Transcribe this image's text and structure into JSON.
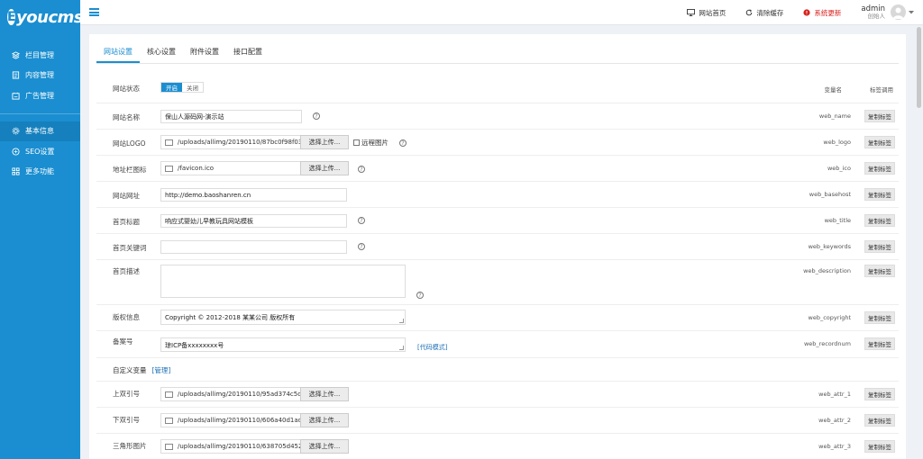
{
  "app": {
    "logo_text": "youcms",
    "logo_mark": "E"
  },
  "sidebar": {
    "items": [
      {
        "label": "栏目管理",
        "icon": "layers-icon"
      },
      {
        "label": "内容管理",
        "icon": "document-icon"
      },
      {
        "label": "广告管理",
        "icon": "ad-icon"
      },
      {
        "label": "基本信息",
        "icon": "gear-icon"
      },
      {
        "label": "SEO设置",
        "icon": "seo-icon"
      },
      {
        "label": "更多功能",
        "icon": "grid-icon"
      }
    ]
  },
  "topbar": {
    "home": "网站首页",
    "clear_cache": "清除缓存",
    "update": "系统更新",
    "user_name": "admin",
    "user_role": "创始人"
  },
  "tabs": [
    "网站设置",
    "核心设置",
    "附件设置",
    "接口配置"
  ],
  "table_header": {
    "var": "变量名",
    "tag": "标签调用"
  },
  "switch": {
    "on": "开启",
    "off": "关闭"
  },
  "upload_button": "选择上传...",
  "copy_label": "复制标签",
  "remote_image": "远程图片",
  "code_mode": "[代码模式]",
  "fields": {
    "status": {
      "label": "网站状态"
    },
    "name": {
      "label": "网站名称",
      "value": "保山人源码网-演示站",
      "var": "web_name"
    },
    "logo": {
      "label": "网站LOGO",
      "value": "/uploads/allimg/20190110/87bc0f98f03",
      "var": "web_logo"
    },
    "ico": {
      "label": "地址栏图标",
      "value": "/favicon.ico",
      "var": "web_ico"
    },
    "url": {
      "label": "网站网址",
      "value": "http://demo.baoshanren.cn",
      "var": "web_basehost"
    },
    "title": {
      "label": "首页标题",
      "value": "响应式婴幼儿早教玩具网站模板",
      "var": "web_title"
    },
    "keywords": {
      "label": "首页关键词",
      "value": "",
      "var": "web_keywords"
    },
    "description": {
      "label": "首页描述",
      "value": "",
      "var": "web_description"
    },
    "copyright": {
      "label": "版权信息",
      "value": "Copyright © 2012-2018 某某公司 版权所有",
      "var": "web_copyright"
    },
    "record": {
      "label": "备案号",
      "value": "琼ICP备xxxxxxxx号",
      "var": "web_recordnum"
    }
  },
  "custom": {
    "title": "自定义变量",
    "manage": "[管理]",
    "items": [
      {
        "label": "上双引号",
        "value": "/uploads/allimg/20190110/95ad374c5d",
        "var": "web_attr_1"
      },
      {
        "label": "下双引号",
        "value": "/uploads/allimg/20190110/606a40d1ad",
        "var": "web_attr_2"
      },
      {
        "label": "三角形图片",
        "value": "/uploads/allimg/20190110/638705d452",
        "var": "web_attr_3"
      }
    ]
  }
}
